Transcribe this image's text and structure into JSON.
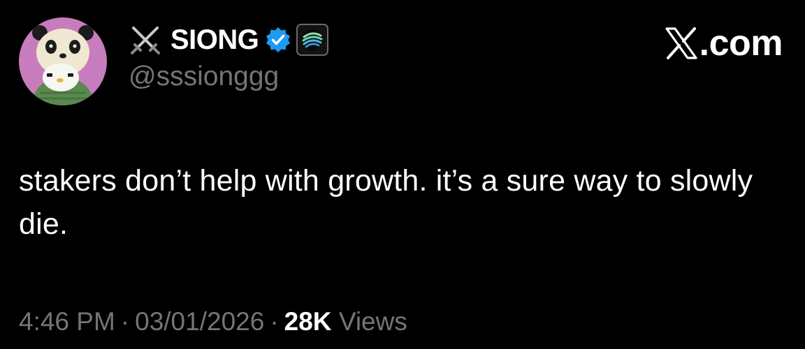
{
  "author": {
    "display_name": "SIONG",
    "handle": "@sssionggg",
    "avatar_icon": "panda-hood-penguin-avatar",
    "prefix_icon": "crossed-swords-icon",
    "verified_icon": "verified-badge-icon",
    "affiliate_icon": "affiliate-badge-icon"
  },
  "brand": {
    "label": ".com",
    "icon": "x-logo-icon"
  },
  "tweet": {
    "text": "stakers don’t help with growth. it’s a sure way to slowly die."
  },
  "meta": {
    "time": "4:46 PM",
    "separator_1": "·",
    "date": "03/01/2026",
    "separator_2": "·",
    "views_count": "28K",
    "views_label": "Views"
  },
  "colors": {
    "background": "#000000",
    "text_primary": "#ffffff",
    "text_secondary": "#71767b",
    "verified_blue": "#1d9bf0",
    "avatar_bg": "#c77dbd"
  }
}
